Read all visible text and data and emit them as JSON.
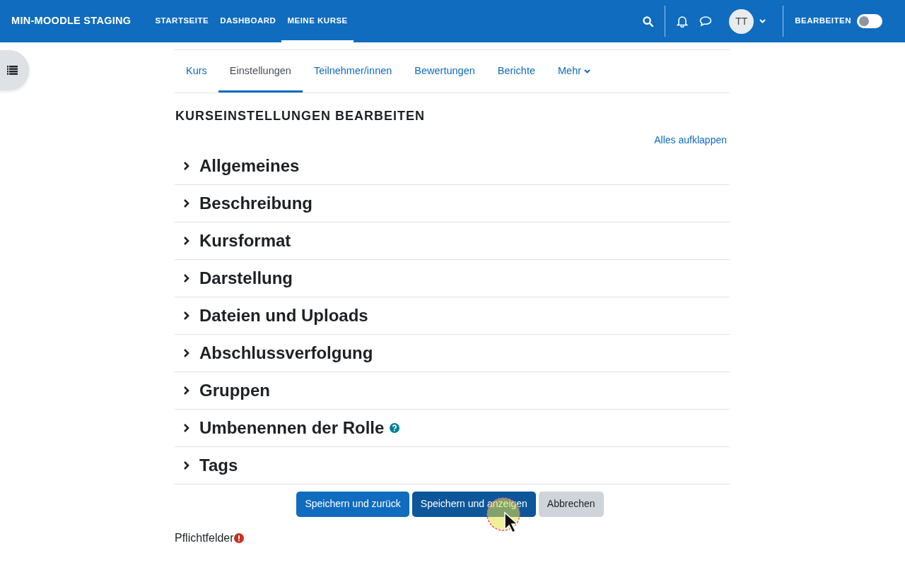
{
  "navbar": {
    "brand": "MIN-MOODLE STAGING",
    "items": [
      {
        "label": "STARTSEITE",
        "selected": false
      },
      {
        "label": "DASHBOARD",
        "selected": false
      },
      {
        "label": "MEINE KURSE",
        "selected": true
      }
    ],
    "avatar": "TT",
    "edit_label": "BEARBEITEN",
    "edit_on": false
  },
  "tabs": [
    {
      "label": "Kurs",
      "selected": false,
      "caret": false
    },
    {
      "label": "Einstellungen",
      "selected": true,
      "caret": false
    },
    {
      "label": "Teilnehmer/innen",
      "selected": false,
      "caret": false
    },
    {
      "label": "Bewertungen",
      "selected": false,
      "caret": false
    },
    {
      "label": "Berichte",
      "selected": false,
      "caret": false
    },
    {
      "label": "Mehr",
      "selected": false,
      "caret": true
    }
  ],
  "heading": "KURSEINSTELLUNGEN BEARBEITEN",
  "expand_all": "Alles aufklappen",
  "sections": [
    {
      "title": "Allgemeines",
      "expanded": false,
      "help": false
    },
    {
      "title": "Beschreibung",
      "expanded": false,
      "help": false
    },
    {
      "title": "Kursformat",
      "expanded": false,
      "help": false
    },
    {
      "title": "Darstellung",
      "expanded": false,
      "help": false
    },
    {
      "title": "Dateien und Uploads",
      "expanded": false,
      "help": false
    },
    {
      "title": "Abschlussverfolgung",
      "expanded": false,
      "help": false
    },
    {
      "title": "Gruppen",
      "expanded": false,
      "help": false
    },
    {
      "title": "Umbenennen der Rolle",
      "expanded": false,
      "help": true
    },
    {
      "title": "Tags",
      "expanded": false,
      "help": false
    }
  ],
  "buttons": [
    {
      "label": "Speichern und zurück",
      "kind": "primary"
    },
    {
      "label": "Speichern und anzeigen",
      "kind": "hover"
    },
    {
      "label": "Abbrechen",
      "kind": "secondary"
    }
  ],
  "required_note": "Pflichtfelder"
}
